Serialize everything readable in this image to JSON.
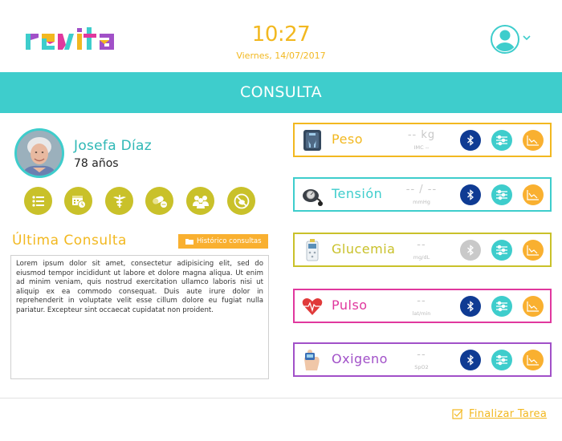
{
  "app": {
    "logo_text": "revita",
    "clock_time": "10:27",
    "clock_date": "Viernes, 14/07/2017"
  },
  "banner": {
    "title": "CONSULTA"
  },
  "patient": {
    "name": "Josefa Díaz",
    "age": "78 años"
  },
  "actions": [
    "list-icon",
    "calendar-clock-icon",
    "caduceus-icon",
    "pills-icon",
    "people-icon",
    "no-food-icon"
  ],
  "last_consult": {
    "title": "Última Consulta",
    "history_button": "Histórico consultas",
    "notes": "Lorem ipsum dolor sit amet, consectetur adipisicing elit, sed do eiusmod tempor incididunt ut labore et dolore magna aliqua. Ut enim ad minim veniam, quis nostrud exercitation ullamco laboris nisi ut aliquip ex ea commodo consequat. Duis aute irure dolor in reprehenderit in voluptate velit esse cillum dolore eu fugiat nulla pariatur. Excepteur sint occaecat cupidatat non proident."
  },
  "measurements": [
    {
      "label": "Peso",
      "value": "-- kg",
      "sub": "IMC --",
      "color": "#f2b820",
      "icon": "scale-icon",
      "bluetooth": "on"
    },
    {
      "label": "Tensión",
      "value": "-- / --",
      "sub": "mmHg",
      "color": "#3ecdcc",
      "icon": "blood-pressure-icon",
      "bluetooth": "on"
    },
    {
      "label": "Glucemia",
      "value": "--",
      "sub": "mg/dL",
      "color": "#c9c12a",
      "icon": "glucometer-icon",
      "bluetooth": "off"
    },
    {
      "label": "Pulso",
      "value": "--",
      "sub": "lat/min",
      "color": "#e0389e",
      "icon": "heart-pulse-icon",
      "bluetooth": "on"
    },
    {
      "label": "Oxigeno",
      "value": "--",
      "sub": "SpO2",
      "color": "#a150c8",
      "icon": "pulse-oximeter-icon",
      "bluetooth": "on"
    }
  ],
  "footer": {
    "finish_label": "Finalizar Tarea"
  },
  "colors": {
    "teal": "#3ecdcc",
    "yellow": "#f2b820",
    "orange": "#f9b030",
    "olive": "#c9c12a",
    "navy": "#0f3b93"
  }
}
